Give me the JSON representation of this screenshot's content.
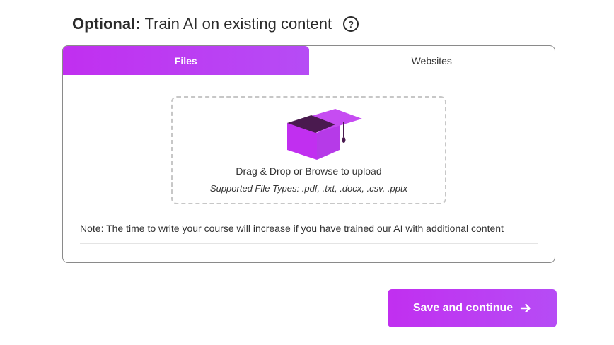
{
  "header": {
    "prefix": "Optional:",
    "title": "Train AI on existing content",
    "help_icon": "question-circle-icon"
  },
  "tabs": [
    {
      "label": "Files",
      "active": true
    },
    {
      "label": "Websites",
      "active": false
    }
  ],
  "dropzone": {
    "icon": "graduation-cap-icon",
    "main_text": "Drag & Drop or Browse to upload",
    "supported_types": "Supported File Types: .pdf, .txt, .docx, .csv, .pptx"
  },
  "note": "Note: The time to write your course will increase if you have trained our AI with additional content",
  "footer": {
    "save_label": "Save and continue",
    "save_icon": "arrow-right-icon"
  },
  "colors": {
    "accent_start": "#c12ff0",
    "accent_end": "#b64cf5",
    "cap_dark": "#4a1a4f"
  }
}
